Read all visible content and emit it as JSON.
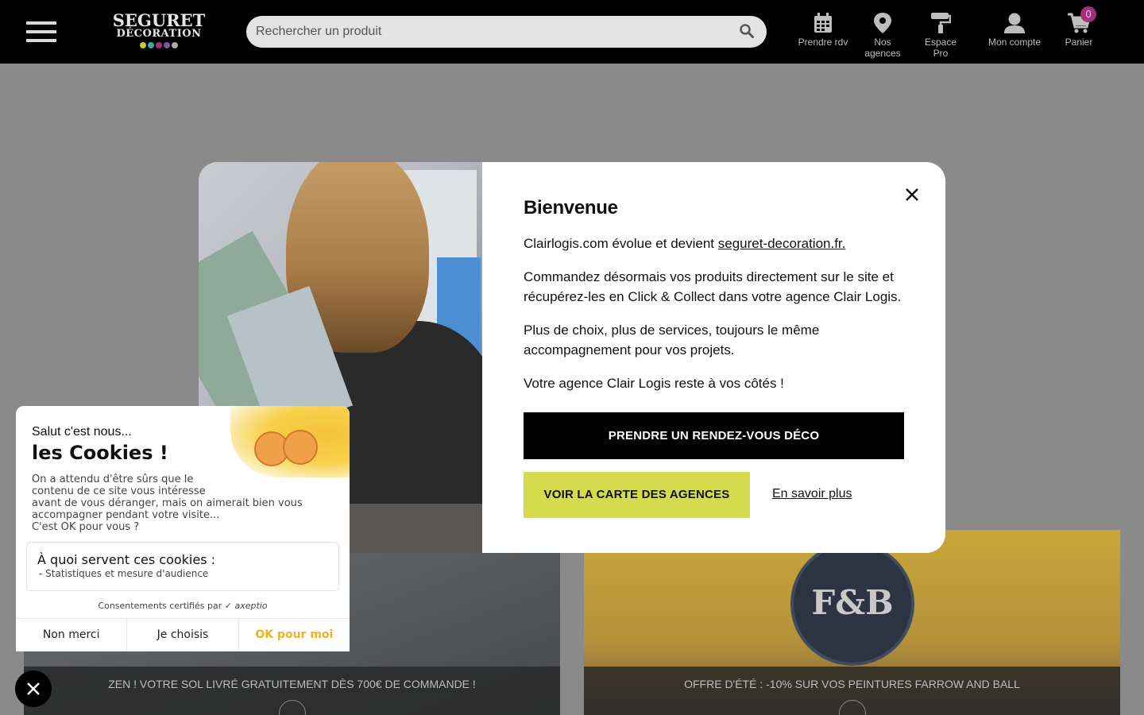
{
  "header": {
    "menu_icon": "hamburger-icon",
    "logo": {
      "line1": "SEGURET",
      "line2": "DÉCORATION",
      "dot_colors": [
        "#c8c83a",
        "#3aa9a0",
        "#a0307a",
        "#7a5aa0",
        "#a8a8a8"
      ]
    },
    "search": {
      "placeholder": "Rechercher un produit",
      "value": "",
      "icon": "search-icon"
    },
    "nav": [
      {
        "label": "Prendre rdv",
        "icon": "calendar-icon"
      },
      {
        "label": "Nos agences",
        "icon": "map-pin-icon"
      },
      {
        "label": "Espace Pro",
        "icon": "paint-roller-icon"
      },
      {
        "label": "Mon compte",
        "icon": "user-icon"
      },
      {
        "label": "Panier",
        "icon": "cart-icon"
      }
    ],
    "cart_count": "0"
  },
  "cards": [
    {
      "caption": "ZEN ! VOTRE SOL LIVRÉ GRATUITEMENT DÈS 700€ DE COMMANDE !"
    },
    {
      "caption": "OFFRE D'ÉTÉ : -10% SUR VOS PEINTURES FARROW AND BALL",
      "seal": "F&B"
    }
  ],
  "modal": {
    "title": "Bienvenue",
    "p1_text": "Clairlogis.com évolue et devient ",
    "p1_link": "seguret-decoration.fr.",
    "p2": "Commandez désormais vos produits directement sur le site et récupérez-les en Click & Collect dans votre agence Clair Logis.",
    "p3": "Plus de choix, plus de services, toujours le même accompagnement pour vos projets.",
    "p4": "Votre agence Clair Logis reste à vos côtés !",
    "btn_primary": "PRENDRE UN RENDEZ-VOUS DÉCO",
    "btn_secondary": "VOIR LA CARTE DES AGENCES",
    "link_more": "En savoir plus",
    "close_icon": "close-icon",
    "colors": {
      "secondary_button": "#d4db4d"
    }
  },
  "cookies": {
    "hello": "Salut c'est nous...",
    "title": "les Cookies !",
    "description": "On a attendu d'être sûrs que le\ncontenu de ce site vous intéresse\navant de vous déranger, mais on aimerait bien vous\naccompagner pendant votre visite...\nC'est OK pour vous ?",
    "purpose_title": "À quoi servent ces cookies :",
    "purpose_item": "- Statistiques et mesure d'audience",
    "certified": "Consentements certifiés par",
    "certified_brand": "axeptio",
    "btn_no": "Non merci",
    "btn_choose": "Je choisis",
    "btn_ok": "OK pour moi",
    "close_icon": "close-icon",
    "colors": {
      "accent": "#f0b21b"
    }
  }
}
